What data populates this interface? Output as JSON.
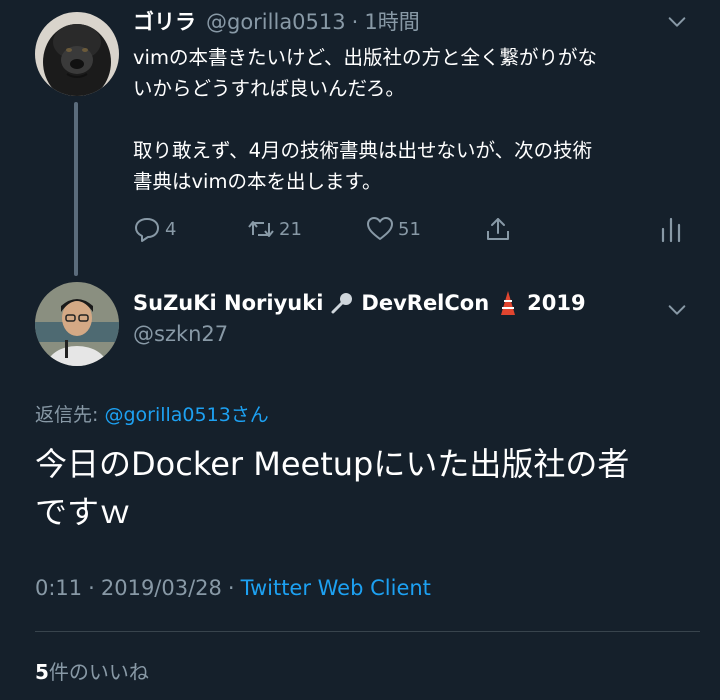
{
  "parent_tweet": {
    "display_name": "ゴリラ",
    "handle": "@gorilla0513",
    "separator": "·",
    "time": "1時間",
    "avatar_icon": "gorilla-avatar",
    "text_line1": "vimの本書きたいけど、出版社の方と全く繋がりがな",
    "text_line2": "いからどうすれば良いんだろ。",
    "text_line3": "取り敢えず、4月の技術書典は出せないが、次の技術",
    "text_line4": "書典はvimの本を出します。",
    "counts": {
      "replies": "4",
      "retweets": "21",
      "likes": "51"
    }
  },
  "main_tweet": {
    "display_name_part1": "SuZuKi Noriyuki",
    "display_name_part2": "DevRelCon",
    "display_name_part3": "2019",
    "handle": "@szkn27",
    "avatar_icon": "person-avatar",
    "reply_to_label": "返信先:",
    "reply_to_user": "@gorilla0513さん",
    "text_line1": "今日のDocker Meetupにいた出版社の者",
    "text_line2": "ですｗ",
    "time": "0:11",
    "date": "2019/03/28",
    "meta_separator": "·",
    "client": "Twitter Web Client",
    "likes_count": "5",
    "likes_label": "件のいいね"
  },
  "colors": {
    "background": "#15202b",
    "text_primary": "#ffffff",
    "text_secondary": "#8899a6",
    "link": "#1da1f2",
    "divider": "#38444d"
  }
}
